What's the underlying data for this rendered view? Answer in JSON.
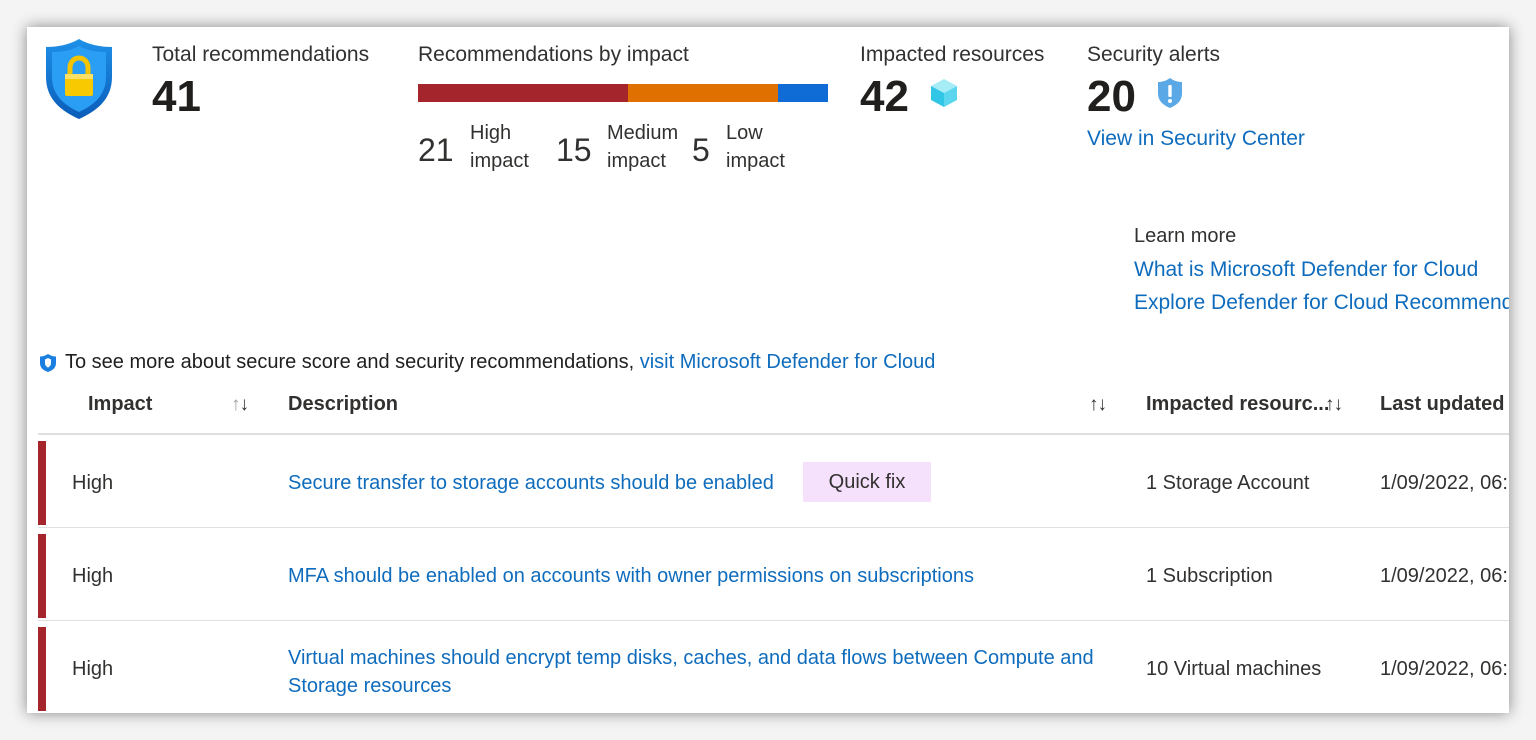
{
  "summary": {
    "total": {
      "label": "Total recommendations",
      "value": "41"
    },
    "by_impact": {
      "label": "Recommendations by impact",
      "high": {
        "count": "21",
        "line1": "High",
        "line2": "impact",
        "value": 21
      },
      "medium": {
        "count": "15",
        "line1": "Medium",
        "line2": "impact",
        "value": 15
      },
      "low": {
        "count": "5",
        "line1": "Low",
        "line2": "impact",
        "value": 5
      }
    },
    "resources": {
      "label": "Impacted resources",
      "value": "42",
      "icon": "cube-icon"
    },
    "alerts": {
      "label": "Security alerts",
      "value": "20",
      "icon": "shield-alert-icon",
      "link": "View in Security Center"
    }
  },
  "learn_more": {
    "label": "Learn more",
    "links": [
      "What is Microsoft Defender for Cloud",
      "Explore Defender for Cloud Recommendations"
    ]
  },
  "info": {
    "text": "To see more about secure score and security recommendations,",
    "link": "visit Microsoft Defender for Cloud"
  },
  "table": {
    "headers": {
      "impact": "Impact",
      "description": "Description",
      "resources": "Impacted resourc...",
      "updated": "Last updated"
    },
    "sort_glyph_up": "↑",
    "sort_glyph_down": "↓",
    "rows": [
      {
        "impact": "High",
        "description": "Secure transfer to storage accounts should be enabled",
        "quick_fix": "Quick fix",
        "resources": "1 Storage Account",
        "updated": "1/09/2022, 06:"
      },
      {
        "impact": "High",
        "description": "MFA should be enabled on accounts with owner permissions on subscriptions",
        "resources": "1 Subscription",
        "updated": "1/09/2022, 06:"
      },
      {
        "impact": "High",
        "description_line1": "Virtual machines should encrypt temp disks, caches, and data flows between Compute and",
        "description_line2": "Storage resources",
        "resources": "10 Virtual machines",
        "updated": "1/09/2022, 06:"
      }
    ]
  },
  "colors": {
    "high": "#a4262c",
    "medium": "#e07000",
    "low": "#0f6cd6",
    "link": "#0f6cbd",
    "quick_fix_bg": "#f5e1fb"
  }
}
